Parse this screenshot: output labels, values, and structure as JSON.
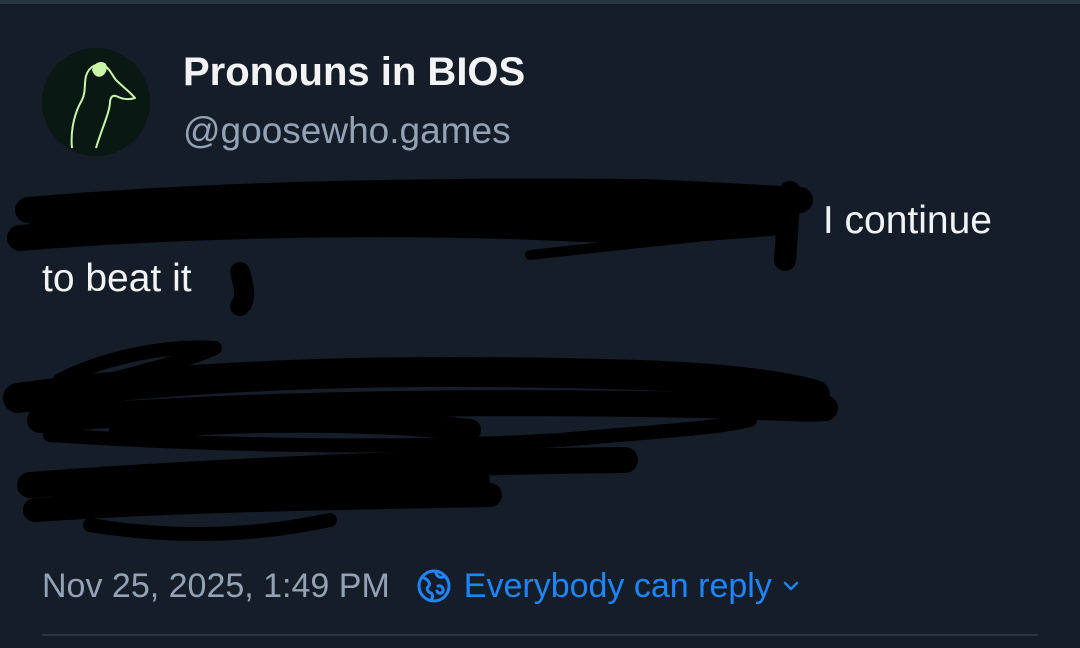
{
  "author": {
    "display_name": "Pronouns in BIOS",
    "handle": "@goosewho.games",
    "avatar_icon": "goose-icon"
  },
  "post": {
    "visible_text_1": "I continue",
    "visible_text_2": "to beat it"
  },
  "meta": {
    "timestamp": "Nov 25, 2025, 1:49 PM",
    "reply_setting": "Everybody can reply",
    "reply_icon": "globe-icon",
    "dropdown_icon": "chevron-down-icon"
  },
  "colors": {
    "background": "#151d28",
    "text_primary": "#f1f3f5",
    "text_secondary": "#93a2b4",
    "accent": "#1f85ff",
    "avatar_green": "#c9f5a7"
  }
}
